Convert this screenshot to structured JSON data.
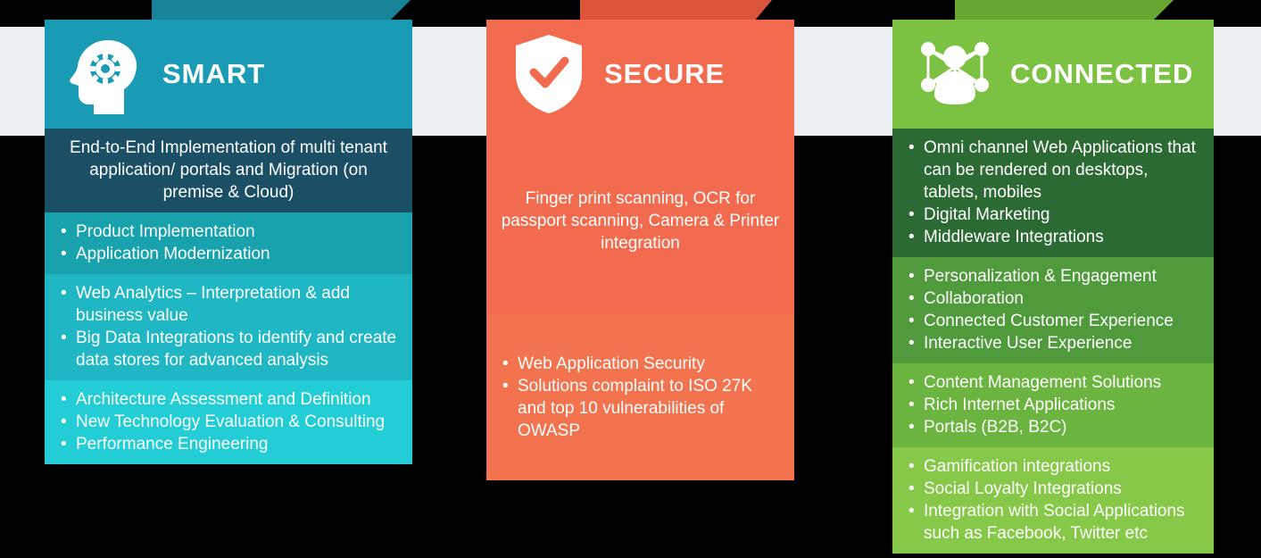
{
  "colors": {
    "smart_header": "#1a9bb5",
    "smart_tail": "#17849a",
    "smart_seg1": "#1a4f66",
    "smart_seg2": "#17a2ae",
    "smart_seg3": "#1fb7c4",
    "smart_seg4": "#22cdd6",
    "secure_header": "#f26b4e",
    "secure_tail": "#d9543a",
    "secure_seg1": "#f26b4e",
    "secure_seg2": "#f4734f",
    "connected_header": "#7cc242",
    "connected_tail": "#68a832",
    "connected_seg1": "#2c6a34",
    "connected_seg2": "#4f9b3b",
    "connected_seg3": "#6bb43f",
    "connected_seg4": "#86c949",
    "band": "#eceff1",
    "background": "#000000",
    "text": "#ffffff"
  },
  "columns": [
    {
      "key": "smart",
      "title": "SMART",
      "icon": "head-gear-icon",
      "segments": [
        {
          "style": "center",
          "paragraph": "End-to-End Implementation of multi tenant application/ portals  and Migration (on premise & Cloud)"
        },
        {
          "style": "bullets",
          "items": [
            "Product Implementation",
            "Application Modernization"
          ]
        },
        {
          "style": "bullets",
          "items": [
            "Web Analytics – Interpretation & add business value",
            "Big Data Integrations to identify and create data stores for advanced analysis"
          ]
        },
        {
          "style": "bullets",
          "items": [
            "Architecture Assessment and Definition",
            "New Technology Evaluation & Consulting",
            "Performance Engineering"
          ]
        }
      ]
    },
    {
      "key": "secure",
      "title": "SECURE",
      "icon": "shield-check-icon",
      "segments": [
        {
          "style": "center",
          "paragraph": "Finger print scanning, OCR for passport scanning, Camera & Printer integration"
        },
        {
          "style": "bullets",
          "items": [
            "Web Application Security",
            "Solutions complaint to ISO 27K and top 10 vulnerabilities of OWASP"
          ]
        }
      ]
    },
    {
      "key": "connected",
      "title": "CONNECTED",
      "icon": "network-people-icon",
      "segments": [
        {
          "style": "bullets",
          "items": [
            "Omni channel Web Applications that can be rendered on desktops, tablets, mobiles",
            "Digital Marketing",
            "Middleware Integrations"
          ]
        },
        {
          "style": "bullets",
          "items": [
            "Personalization & Engagement",
            "Collaboration",
            "Connected Customer Experience",
            "Interactive User Experience"
          ]
        },
        {
          "style": "bullets",
          "items": [
            "Content Management Solutions",
            "Rich Internet Applications",
            "Portals (B2B, B2C)"
          ]
        },
        {
          "style": "bullets",
          "items": [
            "Gamification integrations",
            "Social Loyalty Integrations",
            "Integration with Social Applications such as Facebook, Twitter etc"
          ]
        }
      ]
    }
  ]
}
